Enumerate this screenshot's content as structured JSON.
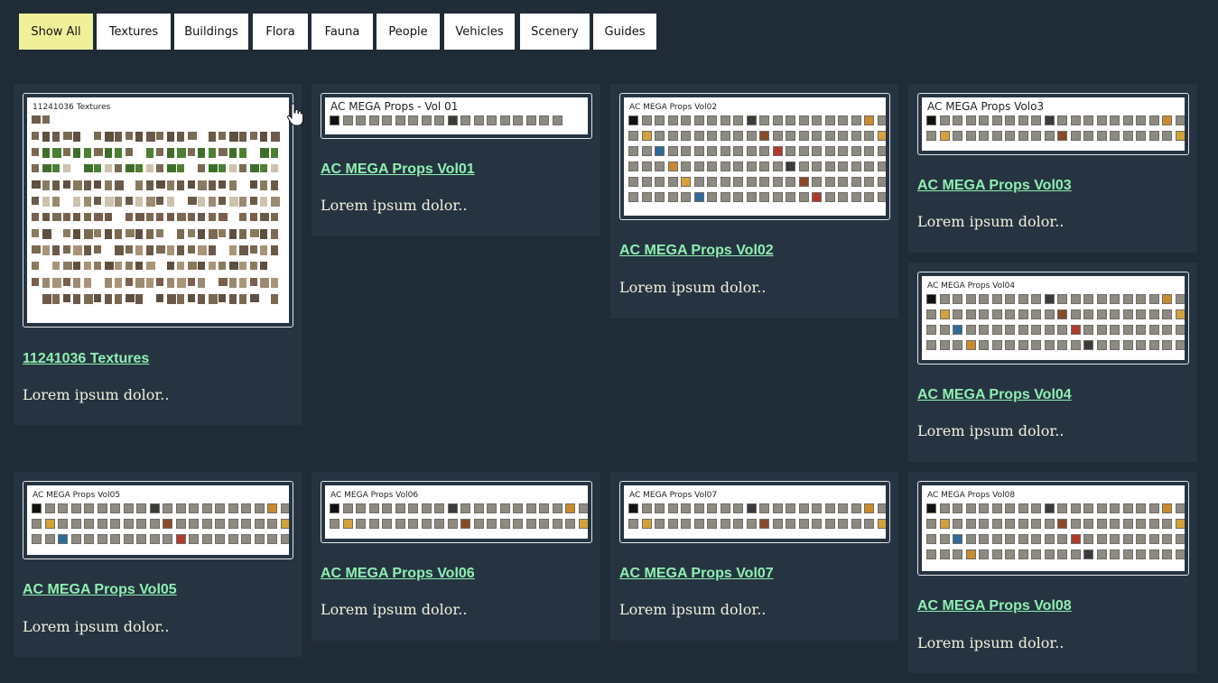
{
  "filters": [
    {
      "label": "Show All",
      "active": true
    },
    {
      "label": "Textures",
      "active": false
    },
    {
      "label": "Buildings",
      "active": false
    },
    {
      "label": "Flora",
      "active": false
    },
    {
      "label": "Fauna",
      "active": false
    },
    {
      "label": "People",
      "active": false
    },
    {
      "label": "Vehicles",
      "active": false
    },
    {
      "label": "Scenery",
      "active": false
    },
    {
      "label": "Guides",
      "active": false
    }
  ],
  "cards": [
    {
      "thumb_title": "11241036 Textures",
      "link": "11241036 Textures",
      "desc": "Lorem ipsum dolor.."
    },
    {
      "thumb_title": "AC MEGA Props - Vol 01",
      "link": "AC MEGA Props Vol01",
      "desc": "Lorem ipsum dolor.."
    },
    {
      "thumb_title": "AC MEGA Props Vol02",
      "link": "AC MEGA Props Vol02",
      "desc": "Lorem ipsum dolor.."
    },
    {
      "thumb_title": "AC MEGA Props Volo3",
      "link": "AC MEGA Props Vol03",
      "desc": "Lorem ipsum dolor.."
    },
    {
      "thumb_title": "AC MEGA Props Vol04",
      "link": "AC MEGA Props Vol04",
      "desc": "Lorem ipsum dolor.."
    },
    {
      "thumb_title": "AC MEGA Props Vol05",
      "link": "AC MEGA Props Vol05",
      "desc": "Lorem ipsum dolor.."
    },
    {
      "thumb_title": "AC MEGA Props Vol06",
      "link": "AC MEGA Props Vol06",
      "desc": "Lorem ipsum dolor.."
    },
    {
      "thumb_title": "AC MEGA Props Vol07",
      "link": "AC MEGA Props Vol07",
      "desc": "Lorem ipsum dolor.."
    },
    {
      "thumb_title": "AC MEGA Props Vol08",
      "link": "AC MEGA Props Vol08",
      "desc": "Lorem ipsum dolor.."
    }
  ],
  "colors": {
    "background": "#1f2b36",
    "card": "#263442",
    "active_filter": "#f0f09a",
    "link": "#8ef0b0",
    "description": "#f2f0dc"
  },
  "icons": {
    "pointer": "hand-pointer-icon"
  }
}
